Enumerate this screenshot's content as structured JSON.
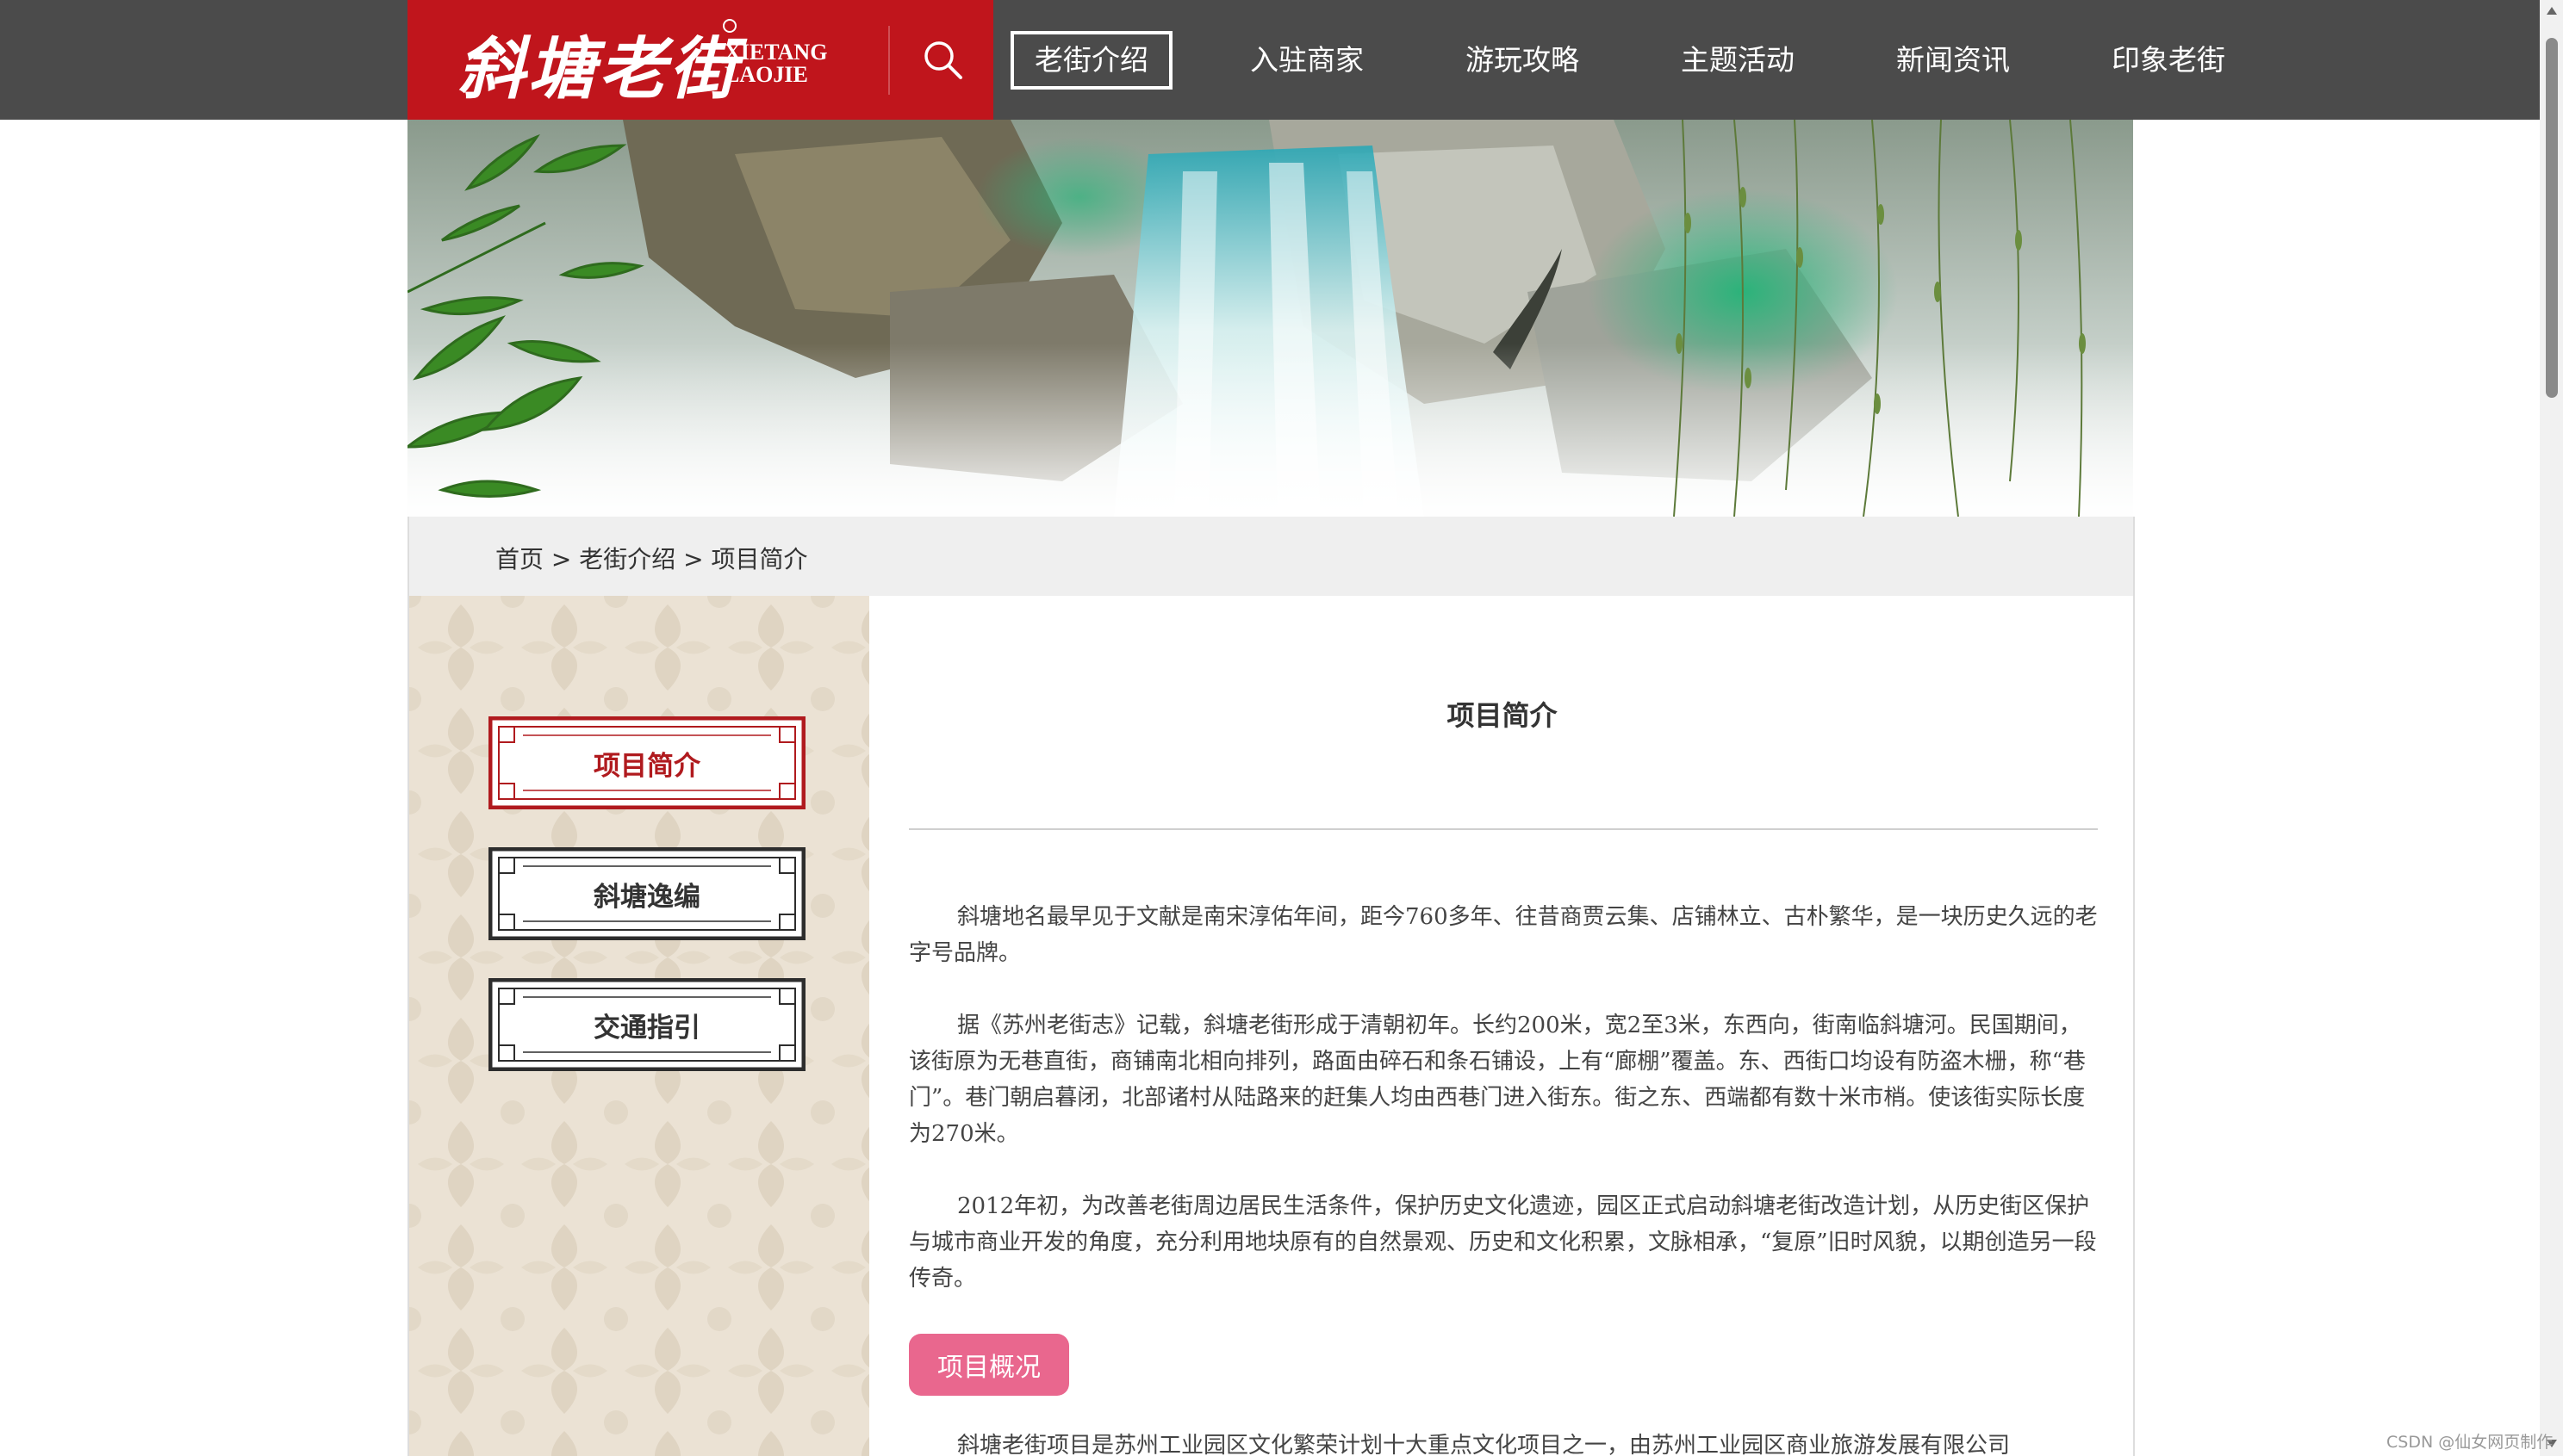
{
  "header": {
    "logo_cn": "斜塘老街",
    "logo_en_line1": "XIETANG",
    "logo_en_line2": "LAOJIE",
    "colors": {
      "bar": "#4b4b4b",
      "logo_bg": "#c0151c"
    },
    "nav": [
      {
        "label": "老街介绍",
        "active": true
      },
      {
        "label": "入驻商家",
        "active": false
      },
      {
        "label": "游玩攻略",
        "active": false
      },
      {
        "label": "主题活动",
        "active": false
      },
      {
        "label": "新闻资讯",
        "active": false
      },
      {
        "label": "印象老街",
        "active": false
      }
    ]
  },
  "breadcrumb": {
    "text": "首页 > 老街介绍 > 项目简介"
  },
  "sidebar": {
    "items": [
      {
        "label": "项目简介",
        "active": true
      },
      {
        "label": "斜塘逸编",
        "active": false
      },
      {
        "label": "交通指引",
        "active": false
      }
    ],
    "colors": {
      "active": "#b01a1e",
      "inactive": "#333333"
    }
  },
  "content": {
    "title": "项目简介",
    "paragraphs": [
      "斜塘地名最早见于文献是南宋淳佑年间，距今760多年、往昔商贾云集、店铺林立、古朴繁华，是一块历史久远的老字号品牌。",
      "据《苏州老街志》记载，斜塘老街形成于清朝初年。长约200米，宽2至3米，东西向，街南临斜塘河。民国期间，该街原为无巷直街，商铺南北相向排列，路面由碎石和条石铺设，上有“廊棚”覆盖。东、西街口均设有防盗木栅，称“巷门”。巷门朝启暮闭，北部诸村从陆路来的赶集人均由西巷门进入街东。街之东、西端都有数十米市梢。使该街实际长度为270米。",
      "2012年初，为改善老街周边居民生活条件，保护历史文化遗迹，园区正式启动斜塘老街改造计划，从历史街区保护与城市商业开发的角度，充分利用地块原有的自然景观、历史和文化积累，文脉相承，“复原”旧时风貌，以期创造另一段传奇。",
      "斜塘老街项目是苏州工业园区文化繁荣计划十大重点文化项目之一，由苏州工业园区商业旅游发展有限公司"
    ],
    "section_button": "项目概况",
    "section_color": "#e9678e"
  },
  "watermark": "CSDN @仙女网页制作"
}
